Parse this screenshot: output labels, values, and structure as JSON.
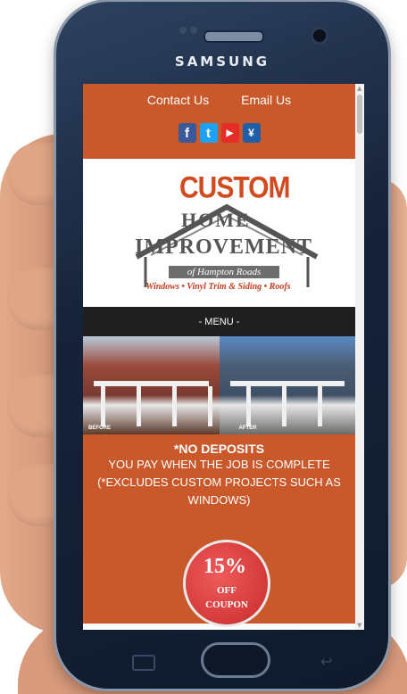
{
  "device": {
    "brand": "SAMSUNG"
  },
  "header": {
    "contact_label": "Contact Us",
    "email_label": "Email Us",
    "socials": [
      {
        "icon": "facebook-icon",
        "glyph": "f",
        "color": "#3b5998"
      },
      {
        "icon": "twitter-icon",
        "glyph": "t",
        "color": "#1da1f2"
      },
      {
        "icon": "youtube-icon",
        "glyph": "▶",
        "color": "#e52d27"
      },
      {
        "icon": "yelp-icon",
        "glyph": "¥",
        "color": "#1f5fa8"
      }
    ]
  },
  "logo": {
    "custom": "CUSTOM",
    "home": "HOME",
    "improvement": "IMPROVEMENT",
    "hampton": "of Hampton Roads",
    "tagline": "Windows • Vinyl Trim & Siding • Roofs"
  },
  "menu": {
    "label": "- MENU -"
  },
  "photos": {
    "before_label": "BEFORE",
    "after_label": "AFTER"
  },
  "promo": {
    "headline": "*NO DEPOSITS",
    "line1": "YOU PAY WHEN THE JOB IS COMPLETE",
    "line2": "(*EXCLUDES CUSTOM PROJECTS SUCH AS",
    "line3": "WINDOWS)"
  },
  "coupon": {
    "percent": "15%",
    "off": "OFF",
    "label": "COUPON"
  },
  "colors": {
    "accent": "#c9582a",
    "menu_bar": "#1f1f1f",
    "phone_body": "#17233a"
  }
}
